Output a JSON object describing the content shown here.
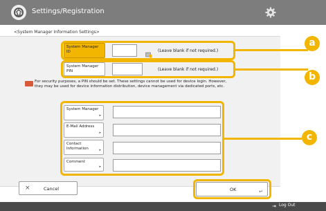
{
  "header": {
    "title": "Settings/Registration"
  },
  "breadcrumb": "<System Manager Information Settings>",
  "fields": {
    "id_label": "System Manager ID",
    "id_note": "(Leave blank if not required.)",
    "pin_label": "System Manager PIN",
    "pin_note": "(Leave blank if not required.)"
  },
  "warning": "For security purposes, a PIN should be set. These settings cannot be used for device login. However, they may be used for device information distribution, device management via dedicated ports, etc.",
  "info_fields": [
    {
      "label": "System Manager"
    },
    {
      "label": "E-Mail Address"
    },
    {
      "label": "Contact Information"
    },
    {
      "label": "Comment"
    }
  ],
  "buttons": {
    "cancel": "Cancel",
    "ok": "OK"
  },
  "footer": {
    "logout": "Log Out"
  },
  "callouts": [
    "a",
    "b",
    "c"
  ],
  "colors": {
    "accent": "#f2b600",
    "header": "#7d7d7d",
    "warning": "#d85a3a"
  }
}
